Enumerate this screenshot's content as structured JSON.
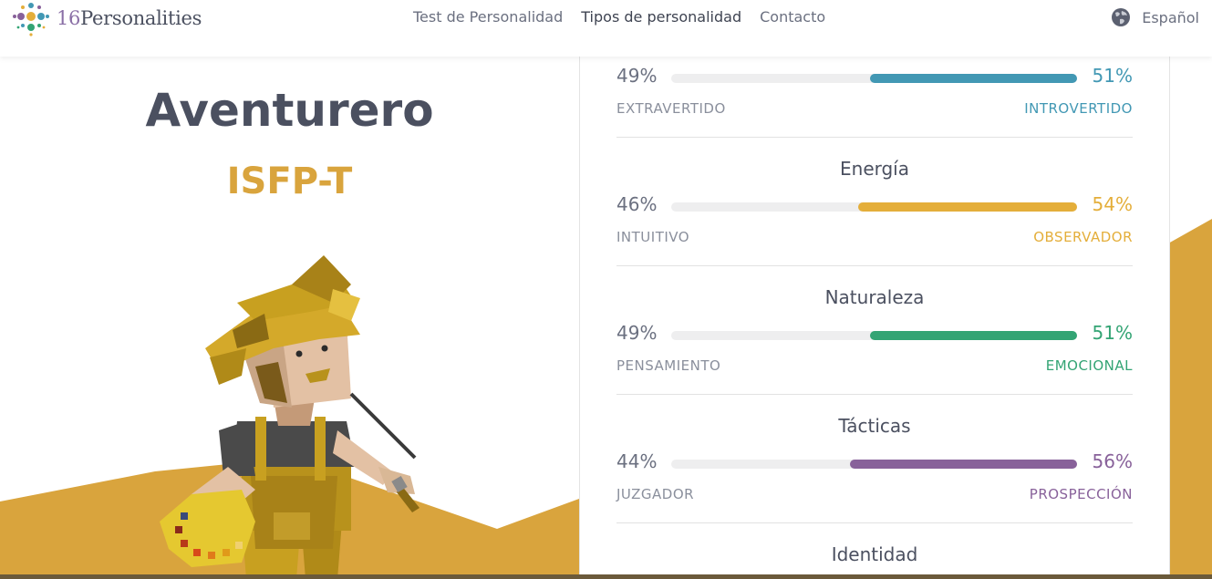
{
  "header": {
    "logo_number": "16",
    "logo_word": "Personalities",
    "nav": [
      {
        "label": "Test de Personalidad",
        "active": false
      },
      {
        "label": "Tipos de personalidad",
        "active": true
      },
      {
        "label": "Contacto",
        "active": false
      }
    ],
    "language": "Español"
  },
  "hero": {
    "type_name": "Aventurero",
    "type_code": "ISFP-T"
  },
  "colors": {
    "mind": "#4298b4",
    "energy": "#e4ae3a",
    "nature": "#33a474",
    "tactics": "#88619a",
    "gold": "#d9a43d"
  },
  "traits": [
    {
      "title": "",
      "left_pct": "49%",
      "right_pct": "51%",
      "left_label": "EXTRAVERTIDO",
      "right_label": "INTROVERTIDO",
      "right_value": 51,
      "color": "#4298b4"
    },
    {
      "title": "Energía",
      "left_pct": "46%",
      "right_pct": "54%",
      "left_label": "INTUITIVO",
      "right_label": "OBSERVADOR",
      "right_value": 54,
      "color": "#e4ae3a"
    },
    {
      "title": "Naturaleza",
      "left_pct": "49%",
      "right_pct": "51%",
      "left_label": "PENSAMIENTO",
      "right_label": "EMOCIONAL",
      "right_value": 51,
      "color": "#33a474"
    },
    {
      "title": "Tácticas",
      "left_pct": "44%",
      "right_pct": "56%",
      "left_label": "JUZGADOR",
      "right_label": "PROSPECCIÓN",
      "right_value": 56,
      "color": "#88619a"
    },
    {
      "title": "Identidad"
    }
  ]
}
